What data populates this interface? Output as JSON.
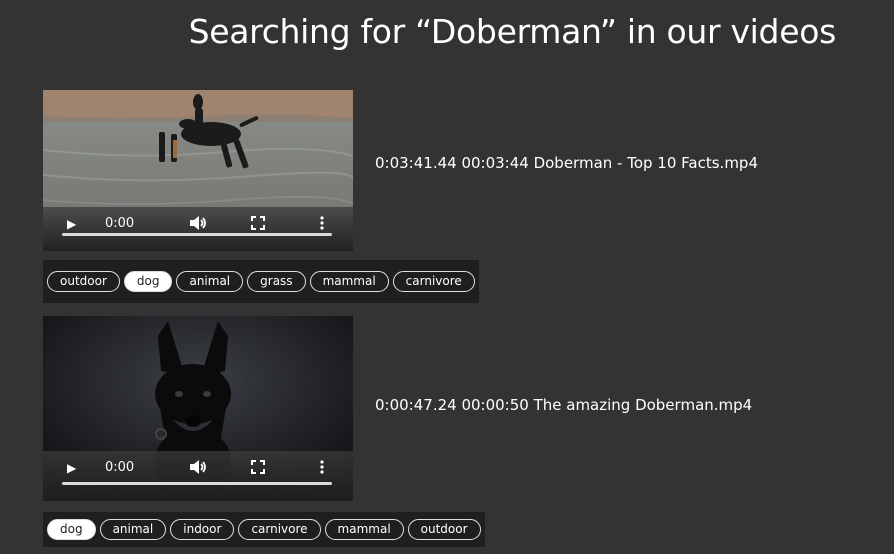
{
  "page": {
    "title": "Searching for “Doberman” in our videos"
  },
  "results": [
    {
      "meta": "0:03:41.44 00:03:44 Doberman - Top 10 Facts.mp4",
      "player": {
        "time": "0:00",
        "play_icon": "▶"
      },
      "tags": [
        "outdoor",
        "dog",
        "animal",
        "grass",
        "mammal",
        "carnivore"
      ],
      "selected_tag": "dog"
    },
    {
      "meta": "0:00:47.24 00:00:50 The amazing Doberman.mp4",
      "player": {
        "time": "0:00",
        "play_icon": "▶"
      },
      "tags": [
        "dog",
        "animal",
        "indoor",
        "carnivore",
        "mammal",
        "outdoor"
      ],
      "selected_tag": "dog"
    }
  ]
}
